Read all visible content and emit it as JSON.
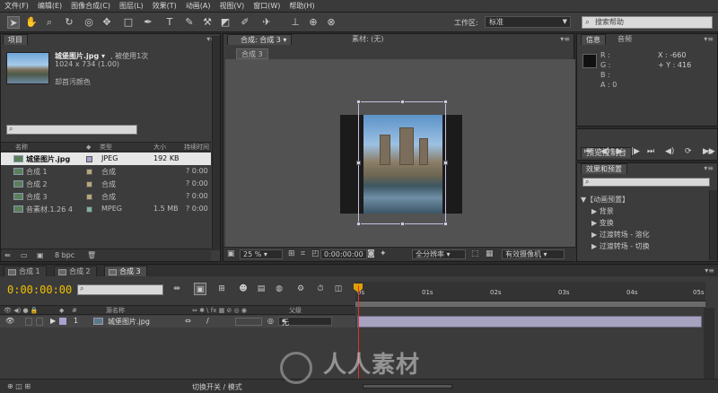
{
  "menu": [
    "文件(F)",
    "编辑(E)",
    "图像合成(C)",
    "图层(L)",
    "效果(T)",
    "动画(A)",
    "视图(V)",
    "窗口(W)",
    "帮助(H)"
  ],
  "toolbar": {
    "workspace_label": "工作区:",
    "workspace_value": "标准",
    "help_placeholder": "搜索帮助"
  },
  "project": {
    "tab": "项目",
    "selected_name": "城堡图片.jpg ▾",
    "used_count": ", 被使用1次",
    "dimensions": "1024 x 734 (1.00)",
    "alpha": "却首污颜色",
    "columns": [
      "名称",
      "类型",
      "大小",
      "持续时间"
    ],
    "rows": [
      {
        "name": "城堡图片.jpg",
        "type": "JPEG",
        "size": "192 KB",
        "duration": "",
        "selected": true,
        "color": "#a7a2d0"
      },
      {
        "name": "合成 1",
        "type": "合成",
        "size": "",
        "duration": "? 0:00",
        "selected": false,
        "color": "#b8a77a"
      },
      {
        "name": "合成 2",
        "type": "合成",
        "size": "",
        "duration": "? 0:00",
        "selected": false,
        "color": "#b8a77a"
      },
      {
        "name": "合成 3",
        "type": "合成",
        "size": "",
        "duration": "? 0:00",
        "selected": false,
        "color": "#b8a77a"
      },
      {
        "name": "音素材.1.26   4",
        "type": "MPEG",
        "size": "1.5 MB",
        "duration": "? 0:00",
        "selected": false,
        "color": "#7fb3a8"
      }
    ],
    "bpc": "8 bpc"
  },
  "composition": {
    "tab": "合成: 合成 3 ▾",
    "footage_tab": "素材: (无)",
    "sub_tab": "合成 3",
    "zoom": "25 %",
    "timecode": "0:00:00:00",
    "resolution": "全分辨率",
    "camera": "有效摄像机"
  },
  "info": {
    "tab": "信息",
    "audio_tab": "音频",
    "r": "R :",
    "g": "G :",
    "b": "B :",
    "a": "A : 0",
    "x": "X : -660",
    "y": "+ Y : 416"
  },
  "preview": {
    "tab": "预览控制台"
  },
  "effects": {
    "tab": "效果和预置",
    "items": [
      "▼【动画预置】",
      "▶ 背景",
      "▶ 变换",
      "▶ 过渡转场 - 溶化",
      "▶ 过渡转场 - 切换"
    ]
  },
  "timeline": {
    "tabs": [
      "合成 1",
      "合成 2",
      "合成 3"
    ],
    "timecode": "0:00:00:00",
    "ticks": [
      "0s",
      "01s",
      "02s",
      "03s",
      "04s",
      "05s"
    ],
    "col_name": "源名称",
    "col_switches": "⇔ ✱ \\ fx ▦ ⊘ ◎ ◉",
    "col_parent": "父级",
    "layer": {
      "num": "1",
      "name": "城堡图片.jpg",
      "parent": "无"
    },
    "footer_toggle": "切换开关 / 模式"
  },
  "watermark": "人人素材"
}
